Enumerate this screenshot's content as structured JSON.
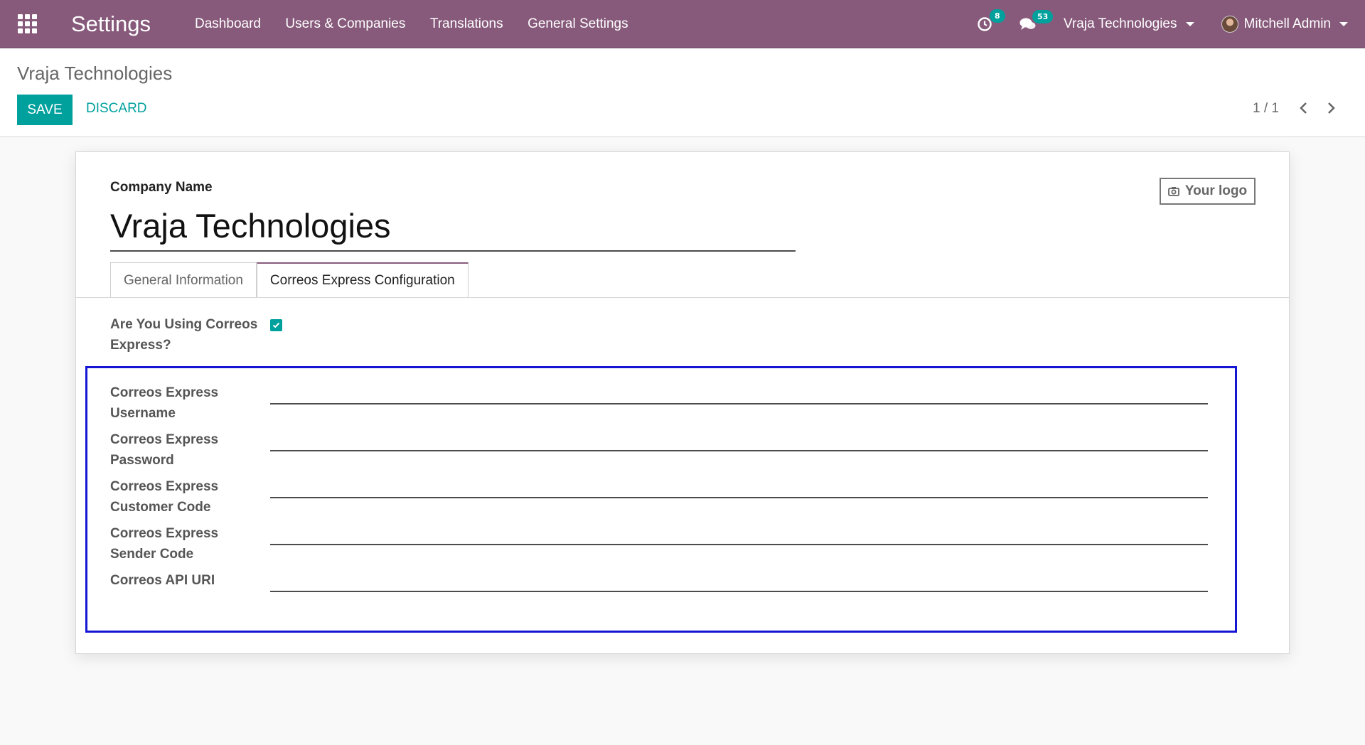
{
  "navbar": {
    "app_title": "Settings",
    "menu": [
      "Dashboard",
      "Users & Companies",
      "Translations",
      "General Settings"
    ],
    "activity_count": "8",
    "messages_count": "53",
    "company": "Vraja Technologies",
    "user": "Mitchell Admin",
    "accent_color": "#875a7b"
  },
  "control": {
    "breadcrumb": "Vraja Technologies",
    "save_label": "SAVE",
    "discard_label": "DISCARD",
    "pager": "1 / 1"
  },
  "form": {
    "company_name_label": "Company Name",
    "company_name": "Vraja Technologies",
    "logo_button": "Your logo",
    "tabs": [
      "General Information",
      "Correos Express Configuration"
    ],
    "active_tab": "Correos Express Configuration",
    "using_correos_label": "Are You Using Correos Express?",
    "using_correos_checked": true,
    "fields": [
      {
        "label": "Correos Express Username",
        "value": ""
      },
      {
        "label": "Correos Express Password",
        "value": ""
      },
      {
        "label": "Correos Express Customer Code",
        "value": ""
      },
      {
        "label": "Correos Express Sender Code",
        "value": ""
      },
      {
        "label": "Correos API URI",
        "value": ""
      }
    ],
    "primary_color": "#00a09d"
  }
}
